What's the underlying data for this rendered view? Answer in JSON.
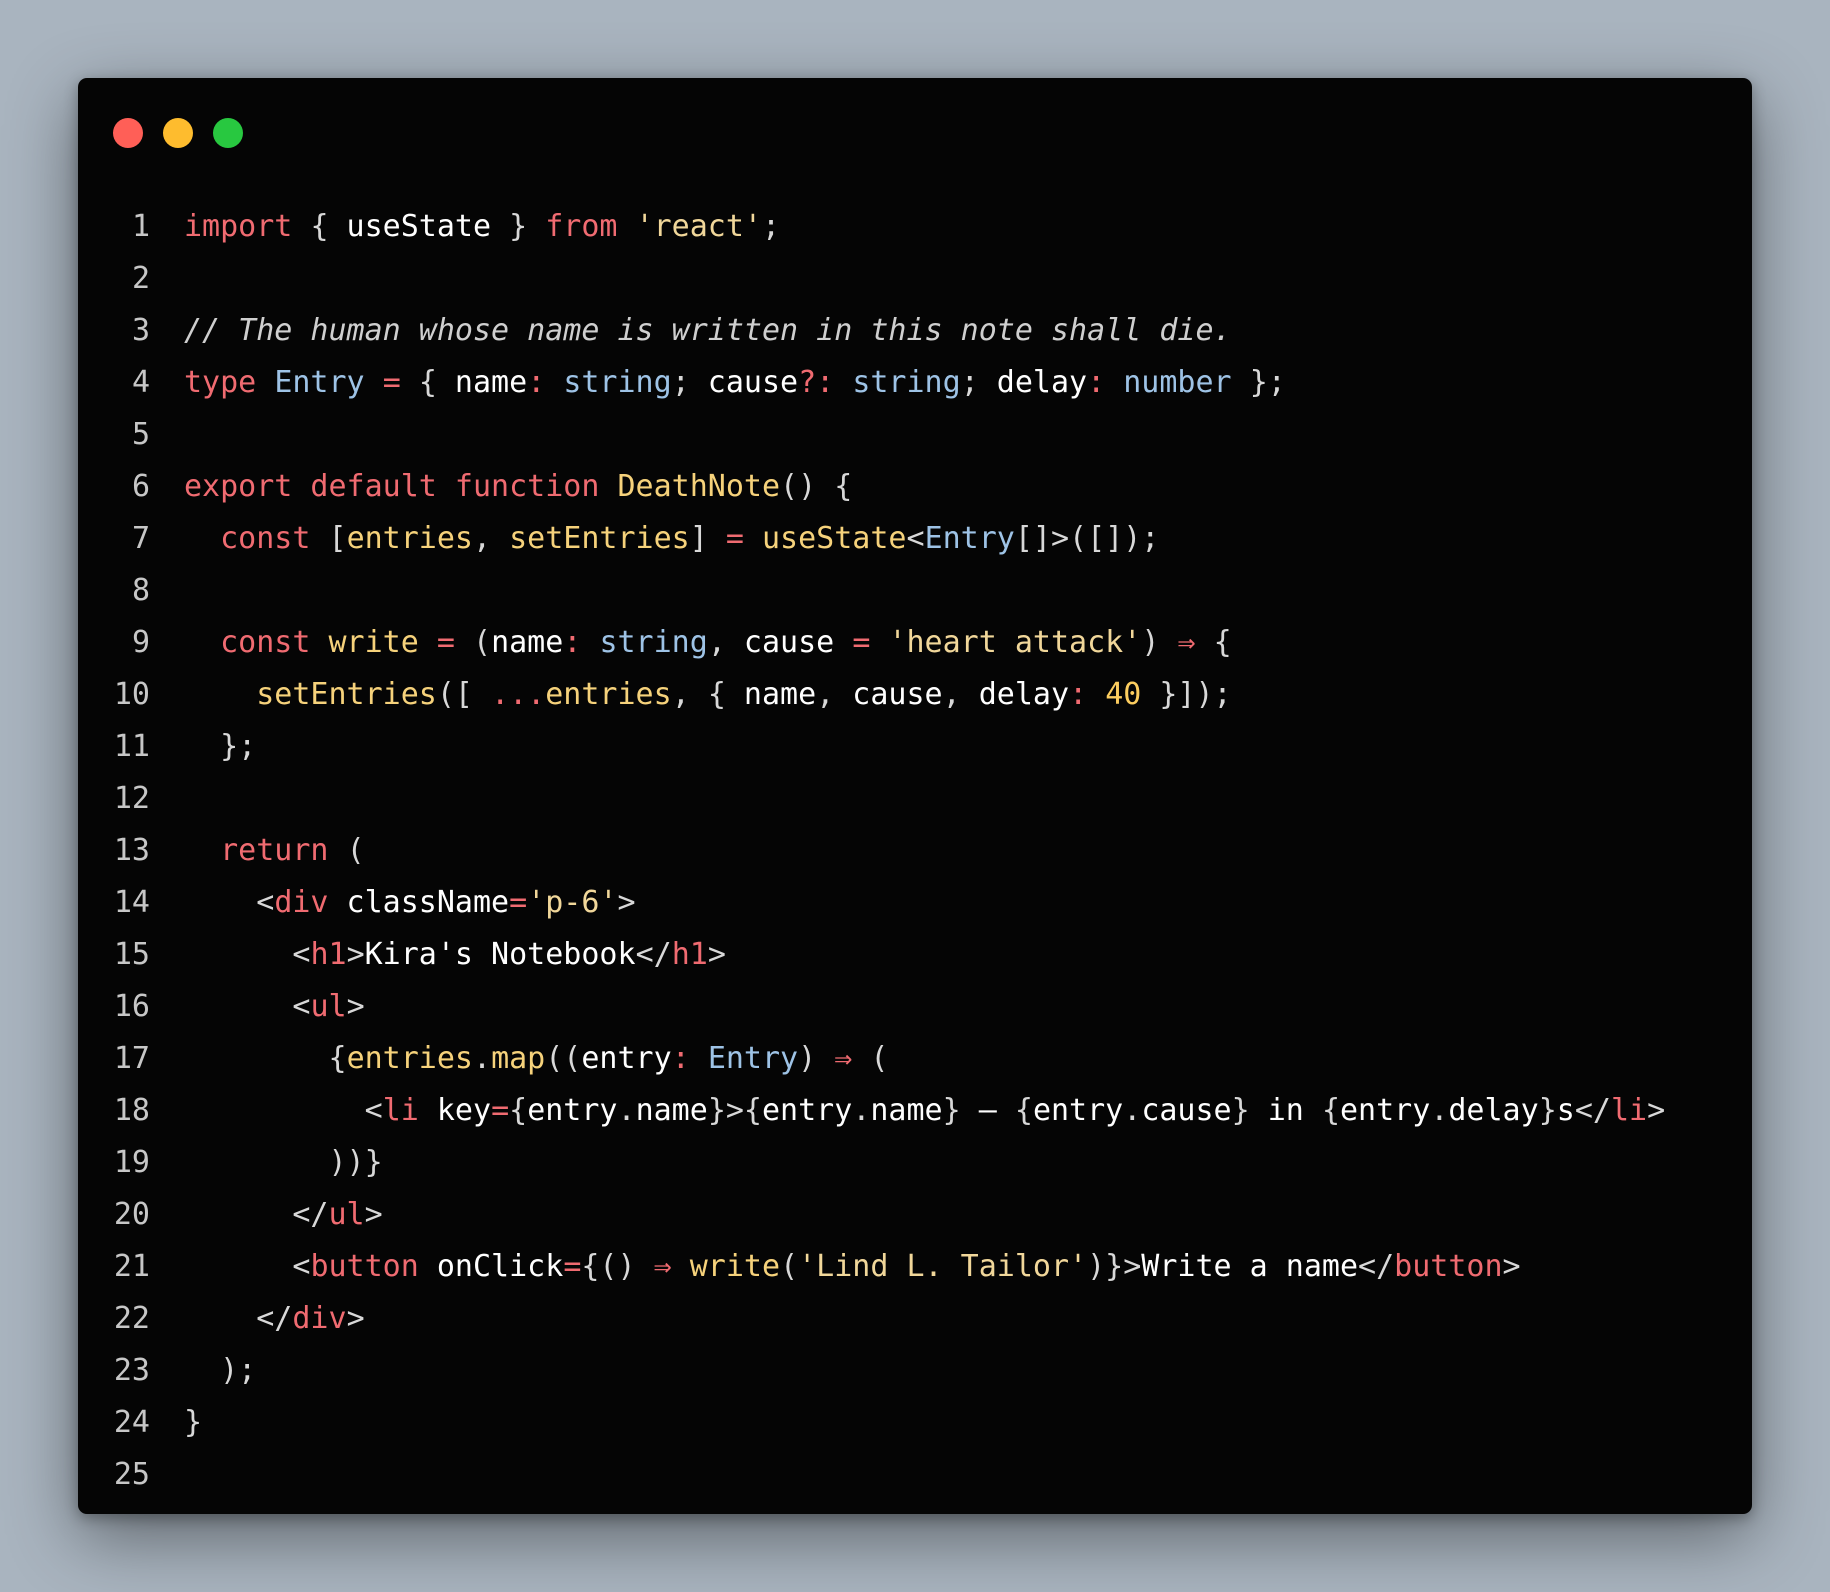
{
  "window": {
    "buttons": [
      "close",
      "minimize",
      "maximize"
    ],
    "colors": {
      "close": "#ff5f57",
      "minimize": "#febc2e",
      "maximize": "#28c840",
      "background": "#050505"
    }
  },
  "editor": {
    "language": "tsx",
    "lines": [
      {
        "n": "1",
        "tokens": [
          [
            "kw",
            "import"
          ],
          [
            "pl",
            " "
          ],
          [
            "pu",
            "{"
          ],
          [
            "pl",
            " useState "
          ],
          [
            "pu",
            "}"
          ],
          [
            "pl",
            " "
          ],
          [
            "kw",
            "from"
          ],
          [
            "pl",
            " "
          ],
          [
            "str",
            "'react'"
          ],
          [
            "pu",
            ";"
          ]
        ]
      },
      {
        "n": "2",
        "tokens": []
      },
      {
        "n": "3",
        "tokens": [
          [
            "cm",
            "// The human whose name is written in this note shall die."
          ]
        ]
      },
      {
        "n": "4",
        "tokens": [
          [
            "kw",
            "type"
          ],
          [
            "pl",
            " "
          ],
          [
            "ty",
            "Entry"
          ],
          [
            "pl",
            " "
          ],
          [
            "op",
            "="
          ],
          [
            "pl",
            " "
          ],
          [
            "pu",
            "{"
          ],
          [
            "pl",
            " name"
          ],
          [
            "op",
            ":"
          ],
          [
            "pl",
            " "
          ],
          [
            "ty",
            "string"
          ],
          [
            "pu",
            ";"
          ],
          [
            "pl",
            " cause"
          ],
          [
            "op",
            "?:"
          ],
          [
            "pl",
            " "
          ],
          [
            "ty",
            "string"
          ],
          [
            "pu",
            ";"
          ],
          [
            "pl",
            " delay"
          ],
          [
            "op",
            ":"
          ],
          [
            "pl",
            " "
          ],
          [
            "ty",
            "number"
          ],
          [
            "pl",
            " "
          ],
          [
            "pu",
            "};"
          ]
        ]
      },
      {
        "n": "5",
        "tokens": []
      },
      {
        "n": "6",
        "tokens": [
          [
            "kw",
            "export default function"
          ],
          [
            "pl",
            " "
          ],
          [
            "fn",
            "DeathNote"
          ],
          [
            "pu",
            "() {"
          ]
        ]
      },
      {
        "n": "7",
        "tokens": [
          [
            "pl",
            "  "
          ],
          [
            "kw",
            "const"
          ],
          [
            "pl",
            " "
          ],
          [
            "pu",
            "["
          ],
          [
            "fn",
            "entries"
          ],
          [
            "pu",
            ","
          ],
          [
            "pl",
            " "
          ],
          [
            "fn",
            "setEntries"
          ],
          [
            "pu",
            "]"
          ],
          [
            "pl",
            " "
          ],
          [
            "op",
            "="
          ],
          [
            "pl",
            " "
          ],
          [
            "fn",
            "useState"
          ],
          [
            "pu",
            "<"
          ],
          [
            "ty",
            "Entry"
          ],
          [
            "pu",
            "[]>([]);"
          ]
        ]
      },
      {
        "n": "8",
        "tokens": []
      },
      {
        "n": "9",
        "tokens": [
          [
            "pl",
            "  "
          ],
          [
            "kw",
            "const"
          ],
          [
            "pl",
            " "
          ],
          [
            "fn",
            "write"
          ],
          [
            "pl",
            " "
          ],
          [
            "op",
            "="
          ],
          [
            "pl",
            " "
          ],
          [
            "pu",
            "("
          ],
          [
            "pl",
            "name"
          ],
          [
            "op",
            ":"
          ],
          [
            "pl",
            " "
          ],
          [
            "ty",
            "string"
          ],
          [
            "pu",
            ","
          ],
          [
            "pl",
            " cause "
          ],
          [
            "op",
            "="
          ],
          [
            "pl",
            " "
          ],
          [
            "str",
            "'heart attack'"
          ],
          [
            "pu",
            ")"
          ],
          [
            "pl",
            " "
          ],
          [
            "op",
            "⇒"
          ],
          [
            "pl",
            " "
          ],
          [
            "pu",
            "{"
          ]
        ]
      },
      {
        "n": "10",
        "tokens": [
          [
            "pl",
            "    "
          ],
          [
            "fn",
            "setEntries"
          ],
          [
            "pu",
            "(["
          ],
          [
            "pl",
            " "
          ],
          [
            "op",
            "..."
          ],
          [
            "fn",
            "entries"
          ],
          [
            "pu",
            ","
          ],
          [
            "pl",
            " "
          ],
          [
            "pu",
            "{"
          ],
          [
            "pl",
            " name"
          ],
          [
            "pu",
            ","
          ],
          [
            "pl",
            " cause"
          ],
          [
            "pu",
            ","
          ],
          [
            "pl",
            " delay"
          ],
          [
            "op",
            ":"
          ],
          [
            "pl",
            " "
          ],
          [
            "num",
            "40"
          ],
          [
            "pl",
            " "
          ],
          [
            "pu",
            "}]);"
          ]
        ]
      },
      {
        "n": "11",
        "tokens": [
          [
            "pl",
            "  "
          ],
          [
            "pu",
            "};"
          ]
        ]
      },
      {
        "n": "12",
        "tokens": []
      },
      {
        "n": "13",
        "tokens": [
          [
            "pl",
            "  "
          ],
          [
            "kw",
            "return"
          ],
          [
            "pl",
            " "
          ],
          [
            "pu",
            "("
          ]
        ]
      },
      {
        "n": "14",
        "tokens": [
          [
            "pl",
            "    "
          ],
          [
            "pu",
            "<"
          ],
          [
            "tag",
            "div"
          ],
          [
            "pl",
            " className"
          ],
          [
            "op",
            "="
          ],
          [
            "str",
            "'p-6'"
          ],
          [
            "pu",
            ">"
          ]
        ]
      },
      {
        "n": "15",
        "tokens": [
          [
            "pl",
            "      "
          ],
          [
            "pu",
            "<"
          ],
          [
            "tag",
            "h1"
          ],
          [
            "pu",
            ">"
          ],
          [
            "pl",
            "Kira's Notebook"
          ],
          [
            "pu",
            "</"
          ],
          [
            "tag",
            "h1"
          ],
          [
            "pu",
            ">"
          ]
        ]
      },
      {
        "n": "16",
        "tokens": [
          [
            "pl",
            "      "
          ],
          [
            "pu",
            "<"
          ],
          [
            "tag",
            "ul"
          ],
          [
            "pu",
            ">"
          ]
        ]
      },
      {
        "n": "17",
        "tokens": [
          [
            "pl",
            "        "
          ],
          [
            "pu",
            "{"
          ],
          [
            "fn",
            "entries"
          ],
          [
            "pu",
            "."
          ],
          [
            "fn",
            "map"
          ],
          [
            "pu",
            "(("
          ],
          [
            "pl",
            "entry"
          ],
          [
            "op",
            ":"
          ],
          [
            "pl",
            " "
          ],
          [
            "ty",
            "Entry"
          ],
          [
            "pu",
            ")"
          ],
          [
            "pl",
            " "
          ],
          [
            "op",
            "⇒"
          ],
          [
            "pl",
            " "
          ],
          [
            "pu",
            "("
          ]
        ]
      },
      {
        "n": "18",
        "tokens": [
          [
            "pl",
            "          "
          ],
          [
            "pu",
            "<"
          ],
          [
            "tag",
            "li"
          ],
          [
            "pl",
            " key"
          ],
          [
            "op",
            "="
          ],
          [
            "pu",
            "{"
          ],
          [
            "pl",
            "entry"
          ],
          [
            "pu",
            "."
          ],
          [
            "pl",
            "name"
          ],
          [
            "pu",
            "}>{"
          ],
          [
            "pl",
            "entry"
          ],
          [
            "pu",
            "."
          ],
          [
            "pl",
            "name"
          ],
          [
            "pu",
            "}"
          ],
          [
            "pl",
            " — "
          ],
          [
            "pu",
            "{"
          ],
          [
            "pl",
            "entry"
          ],
          [
            "pu",
            "."
          ],
          [
            "pl",
            "cause"
          ],
          [
            "pu",
            "}"
          ],
          [
            "pl",
            " in "
          ],
          [
            "pu",
            "{"
          ],
          [
            "pl",
            "entry"
          ],
          [
            "pu",
            "."
          ],
          [
            "pl",
            "delay"
          ],
          [
            "pu",
            "}"
          ],
          [
            "pl",
            "s"
          ],
          [
            "pu",
            "</"
          ],
          [
            "tag",
            "li"
          ],
          [
            "pu",
            ">"
          ]
        ]
      },
      {
        "n": "19",
        "tokens": [
          [
            "pl",
            "        "
          ],
          [
            "pu",
            "))}"
          ]
        ]
      },
      {
        "n": "20",
        "tokens": [
          [
            "pl",
            "      "
          ],
          [
            "pu",
            "</"
          ],
          [
            "tag",
            "ul"
          ],
          [
            "pu",
            ">"
          ]
        ]
      },
      {
        "n": "21",
        "tokens": [
          [
            "pl",
            "      "
          ],
          [
            "pu",
            "<"
          ],
          [
            "tag",
            "button"
          ],
          [
            "pl",
            " onClick"
          ],
          [
            "op",
            "="
          ],
          [
            "pu",
            "{()"
          ],
          [
            "pl",
            " "
          ],
          [
            "op",
            "⇒"
          ],
          [
            "pl",
            " "
          ],
          [
            "fn",
            "write"
          ],
          [
            "pu",
            "("
          ],
          [
            "str",
            "'Lind L. Tailor'"
          ],
          [
            "pu",
            ")}>"
          ],
          [
            "pl",
            "Write a name"
          ],
          [
            "pu",
            "</"
          ],
          [
            "tag",
            "button"
          ],
          [
            "pu",
            ">"
          ]
        ]
      },
      {
        "n": "22",
        "tokens": [
          [
            "pl",
            "    "
          ],
          [
            "pu",
            "</"
          ],
          [
            "tag",
            "div"
          ],
          [
            "pu",
            ">"
          ]
        ]
      },
      {
        "n": "23",
        "tokens": [
          [
            "pl",
            "  "
          ],
          [
            "pu",
            ");"
          ]
        ]
      },
      {
        "n": "24",
        "tokens": [
          [
            "pu",
            "}"
          ]
        ]
      },
      {
        "n": "25",
        "tokens": []
      }
    ]
  }
}
